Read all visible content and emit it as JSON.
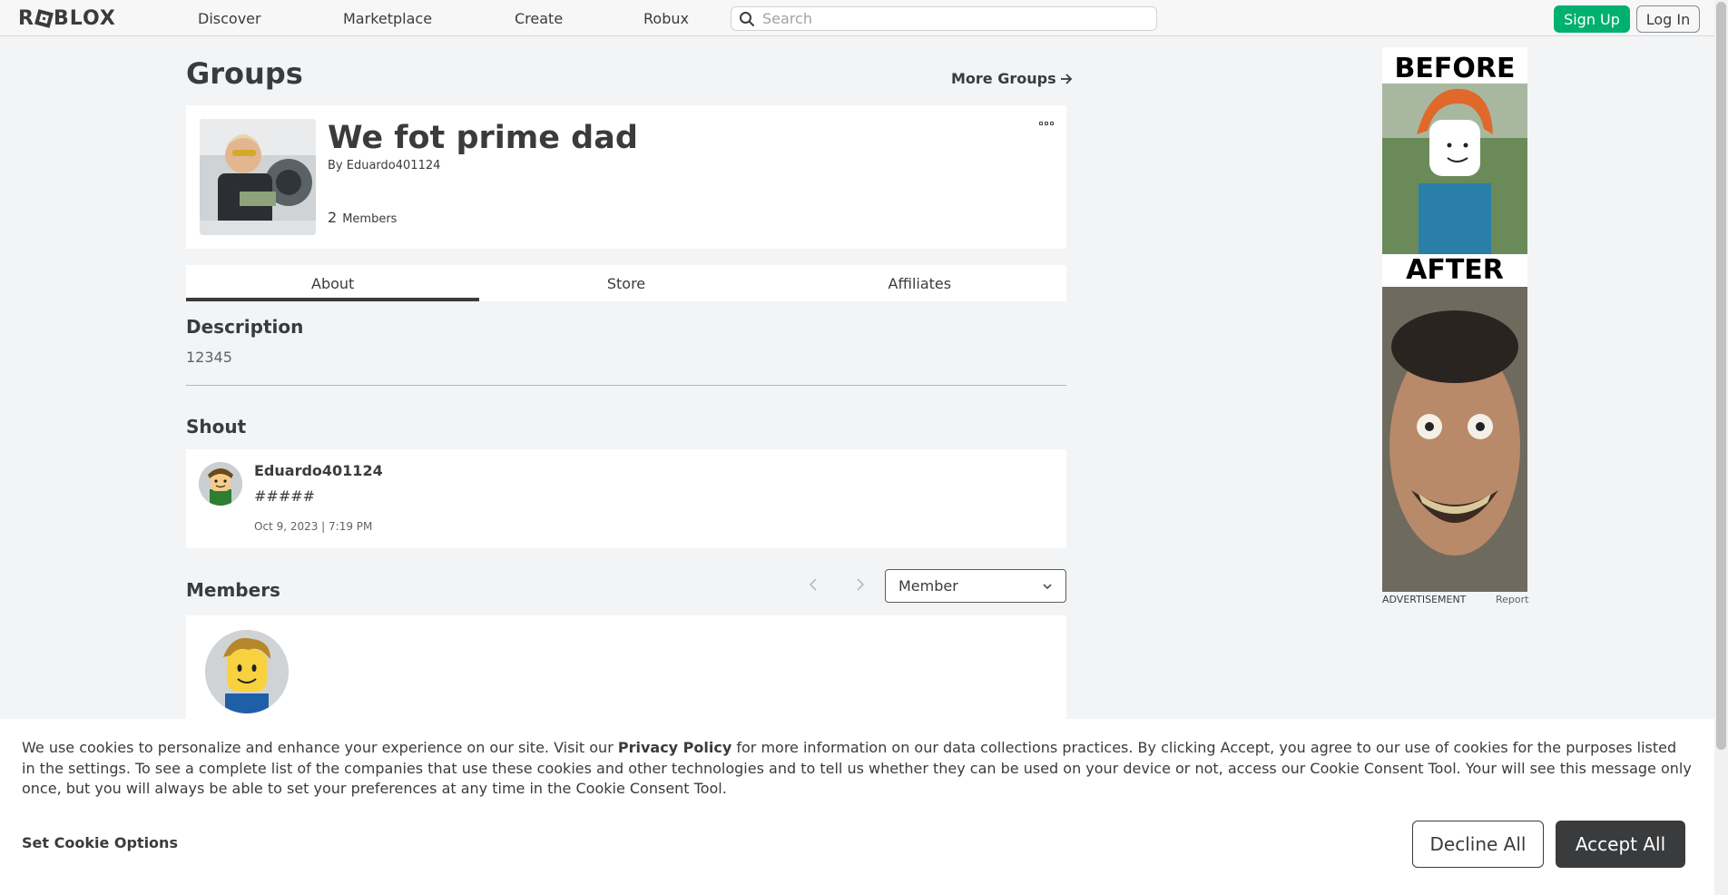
{
  "nav": {
    "logo": "ROBLOX",
    "links": [
      "Discover",
      "Marketplace",
      "Create",
      "Robux"
    ],
    "search_placeholder": "Search",
    "signup": "Sign Up",
    "login": "Log In"
  },
  "page": {
    "title": "Groups",
    "more_groups": "More Groups"
  },
  "group": {
    "name": "We fot prime dad",
    "by_prefix": "By",
    "owner": "Eduardo401124",
    "member_count": "2",
    "member_label": "Members"
  },
  "tabs": [
    "About",
    "Store",
    "Affiliates"
  ],
  "about": {
    "description_heading": "Description",
    "description": "12345",
    "shout_heading": "Shout",
    "shout": {
      "user": "Eduardo401124",
      "body": "#####",
      "date": "Oct 9, 2023 | 7:19 PM"
    },
    "members_heading": "Members",
    "role_selected": "Member"
  },
  "ad": {
    "top_text": "BEFORE",
    "mid_text": "AFTER",
    "label": "ADVERTISEMENT",
    "report": "Report"
  },
  "cookie": {
    "text_before": "We use cookies to personalize and enhance your experience on our site. Visit our ",
    "privacy_link": "Privacy Policy",
    "text_after": " for more information on our data collections practices. By clicking Accept, you agree to our use of cookies for the purposes listed in the settings. To see a complete list of the companies that use these cookies and other technologies and to tell us whether they can be used on your device or not, access our Cookie Consent Tool. Your will see this message only once, but you will always be able to set your preferences at any time in the Cookie Consent Tool.",
    "set_options": "Set Cookie Options",
    "decline": "Decline All",
    "accept": "Accept All"
  },
  "colors": {
    "accent_green": "#00b06f",
    "text_dark": "#393b3d",
    "page_bg": "#f2f4f5"
  }
}
